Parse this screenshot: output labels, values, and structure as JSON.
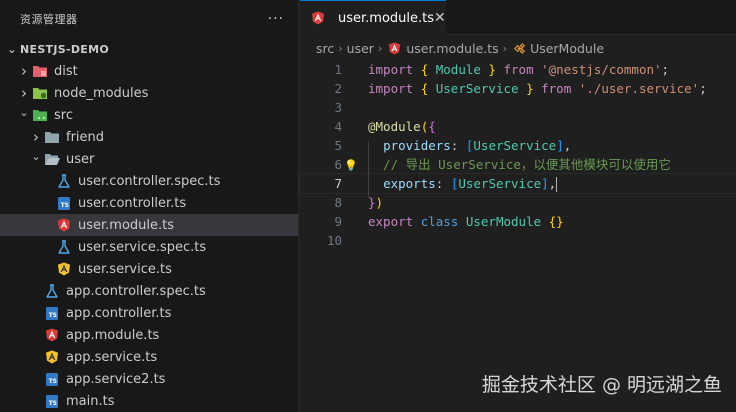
{
  "sidebar": {
    "title": "资源管理器",
    "more_label": "···",
    "project": "NESTJS-DEMO",
    "items": [
      {
        "label": "dist",
        "icon": "dist-folder-icon",
        "indent": 1,
        "chev": "closed"
      },
      {
        "label": "node_modules",
        "icon": "node-folder-icon",
        "indent": 1,
        "chev": "closed"
      },
      {
        "label": "src",
        "icon": "src-folder-icon",
        "indent": 1,
        "chev": "open"
      },
      {
        "label": "friend",
        "icon": "folder-icon",
        "indent": 2,
        "chev": "closed"
      },
      {
        "label": "user",
        "icon": "folder-open-icon",
        "indent": 2,
        "chev": "open"
      },
      {
        "label": "user.controller.spec.ts",
        "icon": "test-flask-icon",
        "indent": 3
      },
      {
        "label": "user.controller.ts",
        "icon": "typescript-icon",
        "indent": 3
      },
      {
        "label": "user.module.ts",
        "icon": "angular-icon",
        "indent": 3,
        "selected": true
      },
      {
        "label": "user.service.spec.ts",
        "icon": "test-flask-icon",
        "indent": 3
      },
      {
        "label": "user.service.ts",
        "icon": "angular-yellow-icon",
        "indent": 3
      },
      {
        "label": "app.controller.spec.ts",
        "icon": "test-flask-icon",
        "indent": 2
      },
      {
        "label": "app.controller.ts",
        "icon": "typescript-icon",
        "indent": 2
      },
      {
        "label": "app.module.ts",
        "icon": "angular-icon",
        "indent": 2
      },
      {
        "label": "app.service.ts",
        "icon": "angular-yellow-icon",
        "indent": 2
      },
      {
        "label": "app.service2.ts",
        "icon": "typescript-icon",
        "indent": 2
      },
      {
        "label": "main.ts",
        "icon": "typescript-icon",
        "indent": 2
      }
    ]
  },
  "tab": {
    "label": "user.module.ts",
    "close": "✕"
  },
  "breadcrumb": {
    "parts": [
      "src",
      "user",
      "user.module.ts",
      "UserModule"
    ]
  },
  "editor": {
    "lines": [
      {
        "n": "1",
        "tokens": [
          [
            "kw2",
            "import "
          ],
          [
            "br",
            "{ "
          ],
          [
            "cls",
            "Module"
          ],
          [
            "br",
            " }"
          ],
          [
            "kw2",
            " from "
          ],
          [
            "str",
            "'@nestjs/common'"
          ],
          [
            "pun",
            ";"
          ]
        ]
      },
      {
        "n": "2",
        "tokens": [
          [
            "kw2",
            "import "
          ],
          [
            "br",
            "{ "
          ],
          [
            "cls",
            "UserService"
          ],
          [
            "br",
            " }"
          ],
          [
            "kw2",
            " from "
          ],
          [
            "str",
            "'./user.service'"
          ],
          [
            "pun",
            ";"
          ]
        ]
      },
      {
        "n": "3",
        "tokens": []
      },
      {
        "n": "4",
        "tokens": [
          [
            "dec",
            "@Module"
          ],
          [
            "br",
            "("
          ],
          [
            "br2",
            "{"
          ]
        ]
      },
      {
        "n": "5",
        "tokens": [
          [
            "pun",
            "  "
          ],
          [
            "prop",
            "providers"
          ],
          [
            "pun",
            ": "
          ],
          [
            "br3",
            "["
          ],
          [
            "cls",
            "UserService"
          ],
          [
            "br3",
            "]"
          ],
          [
            "pun",
            ","
          ]
        ]
      },
      {
        "n": "6",
        "tokens": [
          [
            "cm",
            "  // 导出 UserService，以便其他模块可以使用它"
          ]
        ],
        "bulb": true
      },
      {
        "n": "7",
        "tokens": [
          [
            "pun",
            "  "
          ],
          [
            "prop",
            "exports"
          ],
          [
            "pun",
            ": "
          ],
          [
            "br3",
            "["
          ],
          [
            "cls",
            "UserService"
          ],
          [
            "br3",
            "]"
          ],
          [
            "pun",
            ","
          ]
        ],
        "current": true
      },
      {
        "n": "8",
        "tokens": [
          [
            "br2",
            "}"
          ],
          [
            "br",
            ")"
          ]
        ]
      },
      {
        "n": "9",
        "tokens": [
          [
            "kw2",
            "export "
          ],
          [
            "kw",
            "class "
          ],
          [
            "cls",
            "UserModule "
          ],
          [
            "br",
            "{}"
          ]
        ]
      },
      {
        "n": "10",
        "tokens": []
      }
    ]
  },
  "watermark": "掘金技术社区 @ 明远湖之鱼"
}
